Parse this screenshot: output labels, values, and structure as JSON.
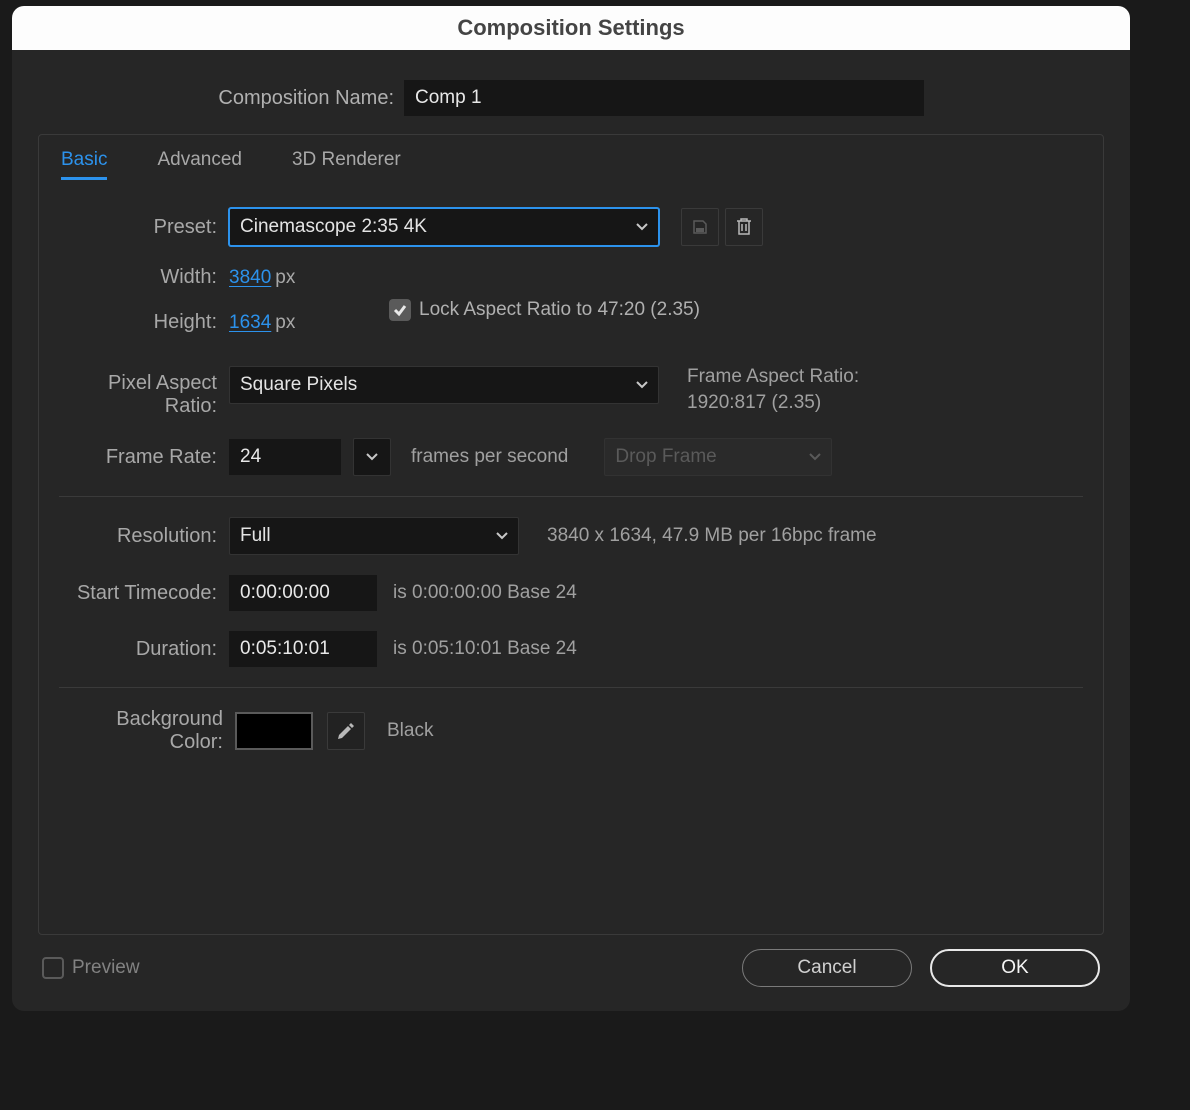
{
  "dialog": {
    "title": "Composition Settings",
    "nameLabel": "Composition Name:",
    "name": "Comp 1"
  },
  "tabs": {
    "basic": "Basic",
    "advanced": "Advanced",
    "renderer": "3D Renderer"
  },
  "preset": {
    "label": "Preset:",
    "value": "Cinemascope 2:35 4K"
  },
  "dimensions": {
    "widthLabel": "Width:",
    "width": "3840",
    "heightLabel": "Height:",
    "height": "1634",
    "unit": "px",
    "lockLabel": "Lock Aspect Ratio to 47:20 (2.35)"
  },
  "par": {
    "label": "Pixel Aspect Ratio:",
    "value": "Square Pixels",
    "frameLabel": "Frame Aspect Ratio:",
    "frameValue": "1920:817 (2.35)"
  },
  "frameRate": {
    "label": "Frame Rate:",
    "value": "24",
    "unit": "frames per second",
    "dropFrame": "Drop Frame"
  },
  "resolution": {
    "label": "Resolution:",
    "value": "Full",
    "info": "3840 x 1634, 47.9 MB per 16bpc frame"
  },
  "startTC": {
    "label": "Start Timecode:",
    "value": "0:00:00:00",
    "info": "is 0:00:00:00  Base 24"
  },
  "duration": {
    "label": "Duration:",
    "value": "0:05:10:01",
    "info": "is 0:05:10:01  Base 24"
  },
  "bgColor": {
    "label": "Background Color:",
    "name": "Black",
    "hex": "#000000"
  },
  "footer": {
    "preview": "Preview",
    "cancel": "Cancel",
    "ok": "OK"
  }
}
